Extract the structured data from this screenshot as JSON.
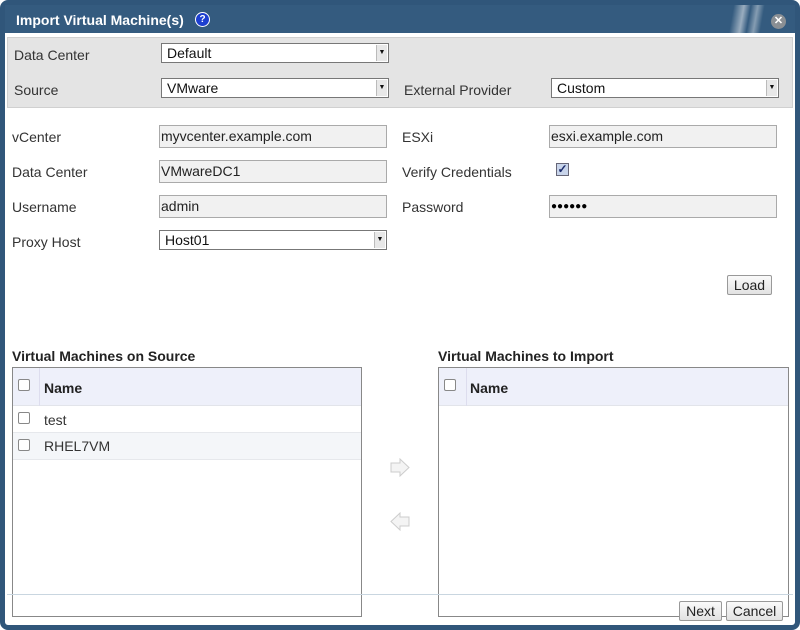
{
  "dialog": {
    "title": "Import Virtual Machine(s)",
    "help_icon": "question-circle-icon",
    "close_icon": "close-icon"
  },
  "top": {
    "data_center_label": "Data Center",
    "data_center_value": "Default",
    "source_label": "Source",
    "source_value": "VMware",
    "external_provider_label": "External Provider",
    "external_provider_value": "Custom"
  },
  "form": {
    "vcenter_label": "vCenter",
    "vcenter_value": "myvcenter.example.com",
    "esxi_label": "ESXi",
    "esxi_value": "esxi.example.com",
    "datacenter_label": "Data Center",
    "datacenter_value": "VMwareDC1",
    "verify_label": "Verify Credentials",
    "verify_checked": true,
    "username_label": "Username",
    "username_value": "admin",
    "password_label": "Password",
    "password_value": "●●●●●●",
    "proxy_label": "Proxy Host",
    "proxy_value": "Host01",
    "load_label": "Load"
  },
  "source_list": {
    "title": "Virtual Machines on Source",
    "column": "Name",
    "rows": [
      "test",
      "RHEL7VM"
    ]
  },
  "import_list": {
    "title": "Virtual Machines to Import",
    "column": "Name",
    "rows": []
  },
  "footer": {
    "next_label": "Next",
    "cancel_label": "Cancel"
  }
}
